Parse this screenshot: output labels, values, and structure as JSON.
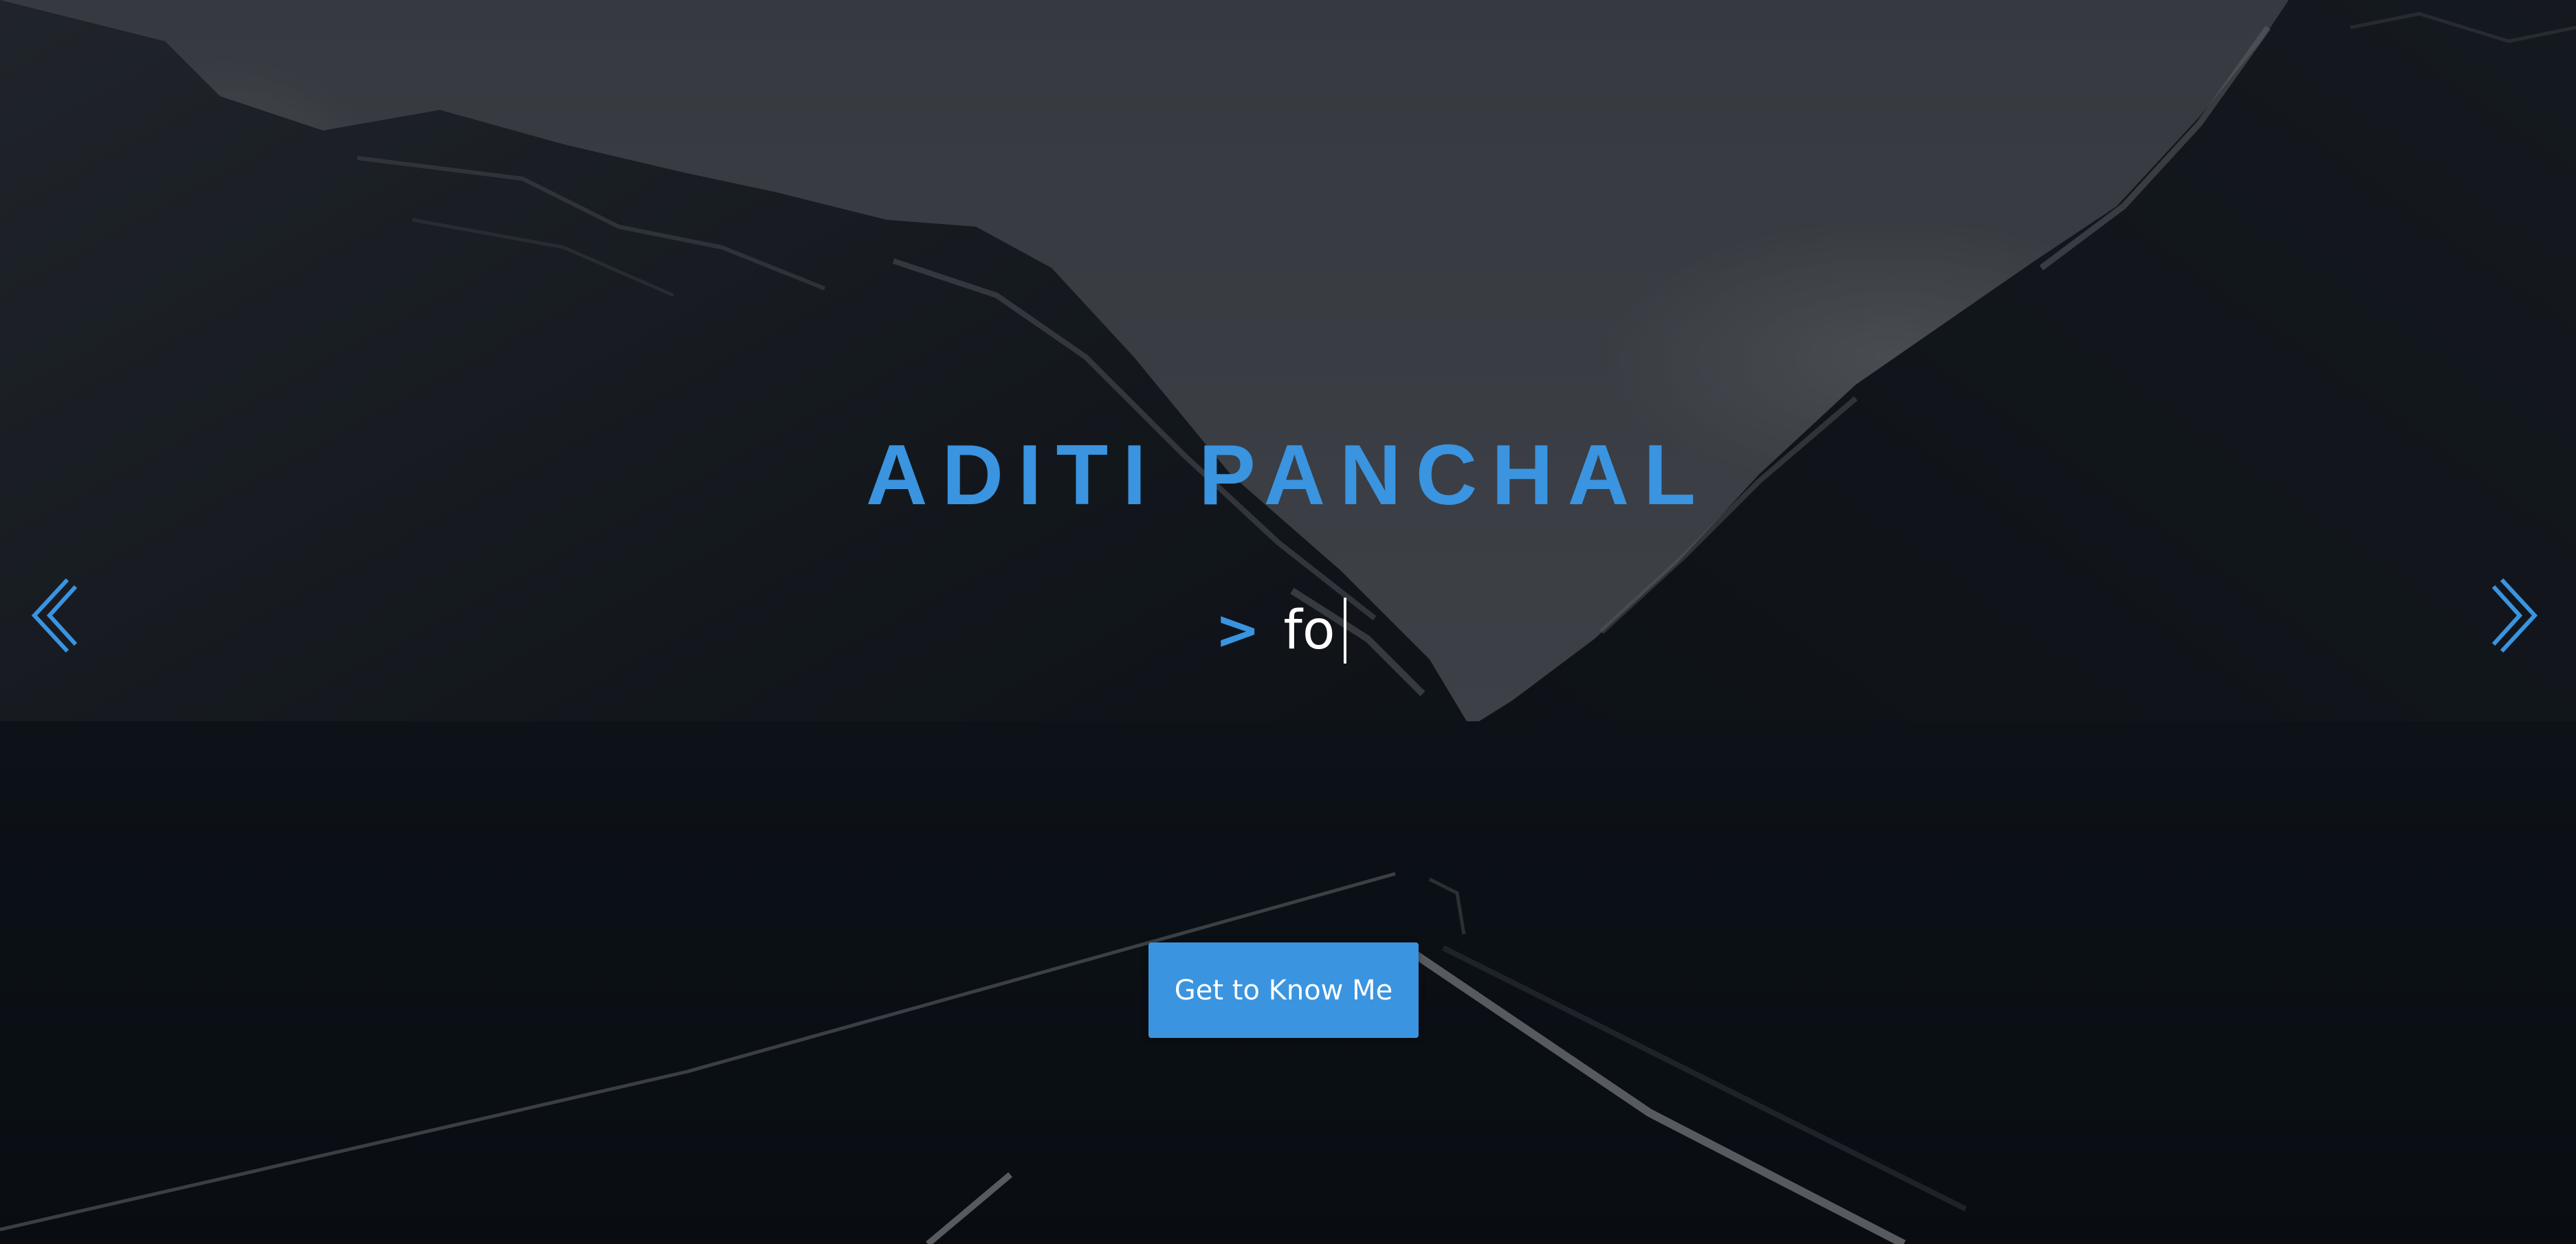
{
  "hero": {
    "name": "ADITI PANCHAL",
    "prompt_symbol": ">",
    "typed_text": "fo",
    "cta_label": "Get to Know Me"
  },
  "carousel": {
    "prev_icon": "chevron-left-icon",
    "next_icon": "chevron-right-icon"
  },
  "colors": {
    "accent": "#3a94e0",
    "text": "#ffffff",
    "overlay": "#0b1016"
  }
}
